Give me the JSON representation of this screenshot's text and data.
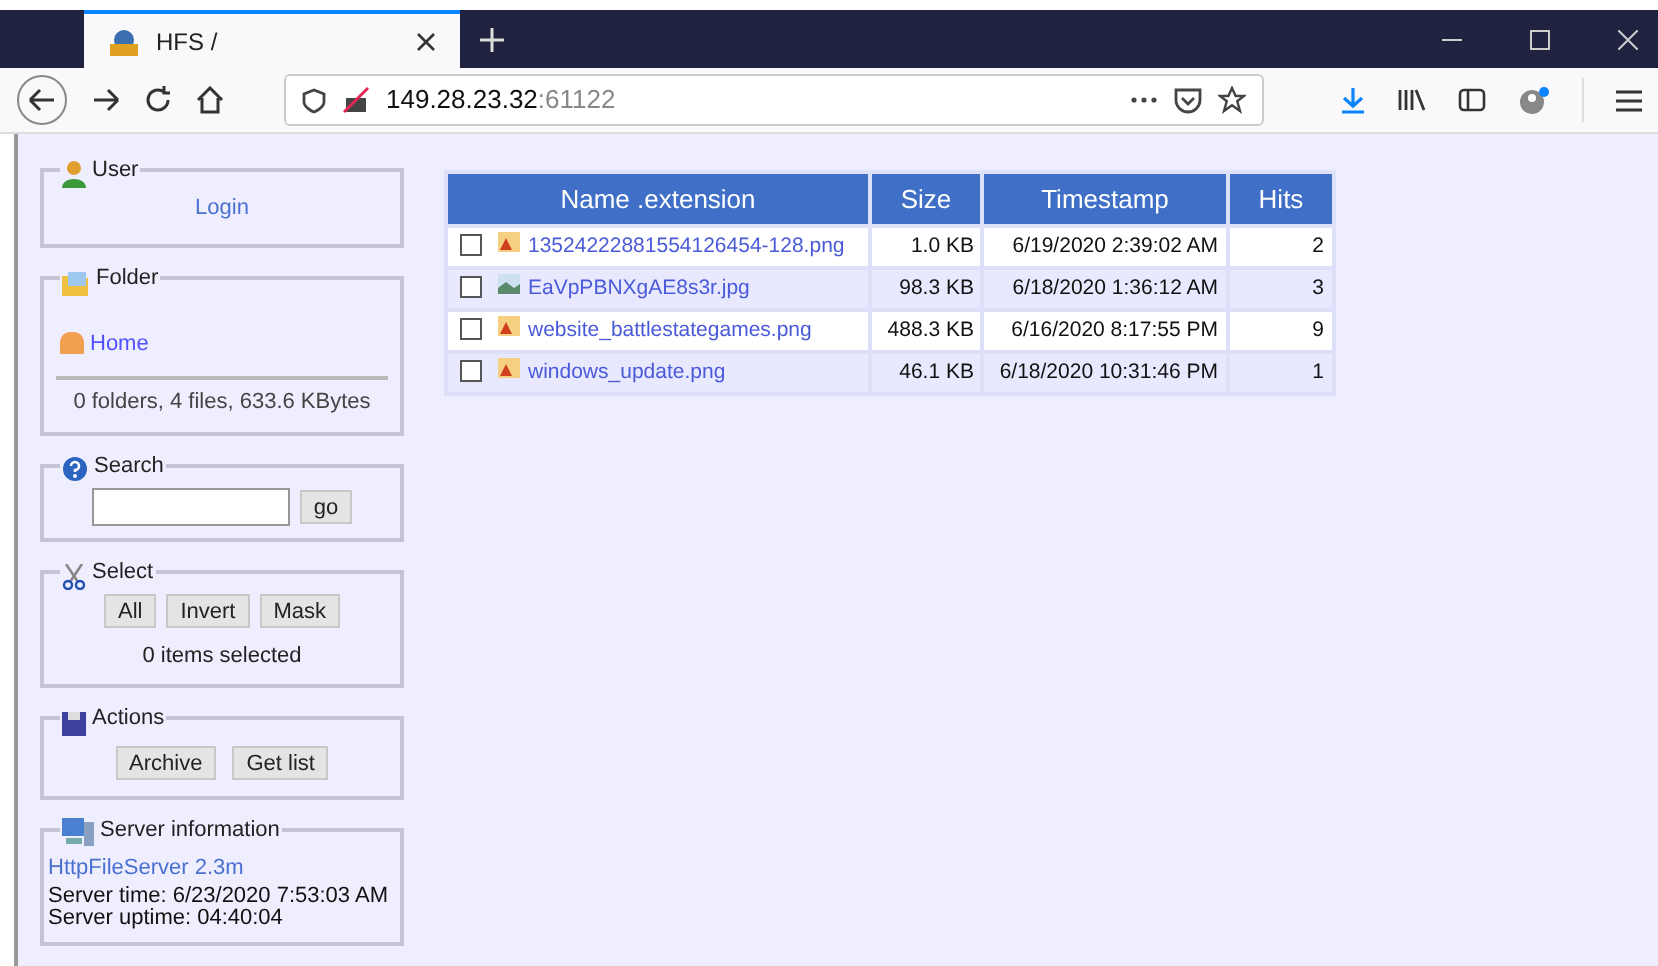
{
  "browser": {
    "tab": {
      "title": "HFS /"
    },
    "address": {
      "host": "149.28.23.32",
      "port": ":61122"
    }
  },
  "sidebar": {
    "user": {
      "legend": "User",
      "link": "Login"
    },
    "folder": {
      "legend": "Folder",
      "link": "Home",
      "info": "0 folders, 4 files, 633.6 KBytes"
    },
    "search": {
      "legend": "Search",
      "button": "go"
    },
    "select": {
      "legend": "Select",
      "buttons": [
        "All",
        "Invert",
        "Mask"
      ],
      "status": "0 items selected"
    },
    "actions": {
      "legend": "Actions",
      "buttons": [
        "Archive",
        "Get list"
      ]
    },
    "server": {
      "legend": "Server information",
      "link": "HttpFileServer 2.3m",
      "lines": [
        "Server time: 6/23/2020 7:53:03 AM",
        "Server uptime: 04:40:04"
      ]
    }
  },
  "table": {
    "columns": [
      "Name .extension",
      "Size",
      "Timestamp",
      "Hits"
    ],
    "rows": [
      {
        "checked": false,
        "kind": "png",
        "name": "13524222881554126454-128.png",
        "size": "1.0 KB",
        "timestamp": "6/19/2020 2:39:02 AM",
        "hits": "2"
      },
      {
        "checked": false,
        "kind": "jpg",
        "name": "EaVpPBNXgAE8s3r.jpg",
        "size": "98.3 KB",
        "timestamp": "6/18/2020 1:36:12 AM",
        "hits": "3"
      },
      {
        "checked": false,
        "kind": "png",
        "name": "website_battlestategames.png",
        "size": "488.3 KB",
        "timestamp": "6/16/2020 8:17:55 PM",
        "hits": "9"
      },
      {
        "checked": false,
        "kind": "png",
        "name": "windows_update.png",
        "size": "46.1 KB",
        "timestamp": "6/18/2020 10:31:46 PM",
        "hits": "1"
      }
    ]
  }
}
